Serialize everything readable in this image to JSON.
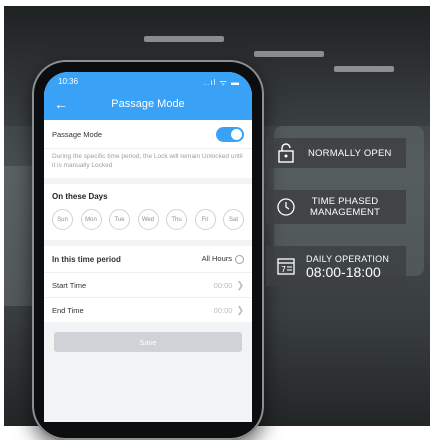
{
  "phone": {
    "status_time": "10:36",
    "status_icons": "..ıl ᯤ ▬",
    "header": {
      "back_icon": "arrow-left-icon",
      "title": "Passage Mode"
    },
    "passage_mode": {
      "label": "Passage Mode",
      "enabled": true
    },
    "description": "During the specific time period, the Lock will remain Unlocked until it is manually Locked",
    "days_section": {
      "title": "On these Days",
      "days": [
        "Sun",
        "Mon",
        "Tue",
        "Wed",
        "Thu",
        "Fri",
        "Sat"
      ]
    },
    "time_section": {
      "title": "In this time period",
      "all_hours_label": "All Hours",
      "start_label": "Start Time",
      "start_value": "00:00",
      "end_label": "End Time",
      "end_value": "00:00"
    },
    "save_label": "Save"
  },
  "features": [
    {
      "icon": "unlocked-padlock-icon",
      "line1": "NORMALLY OPEN",
      "line2": ""
    },
    {
      "icon": "clock-icon",
      "line1": "TIME PHASED",
      "line2": "MANAGEMENT"
    },
    {
      "icon": "calendar-icon",
      "line1": "DAILY OPERATION",
      "line2": "08:00-18:00"
    }
  ],
  "colors": {
    "accent": "#3aa2f6",
    "badge_bg": "#3c4042"
  }
}
